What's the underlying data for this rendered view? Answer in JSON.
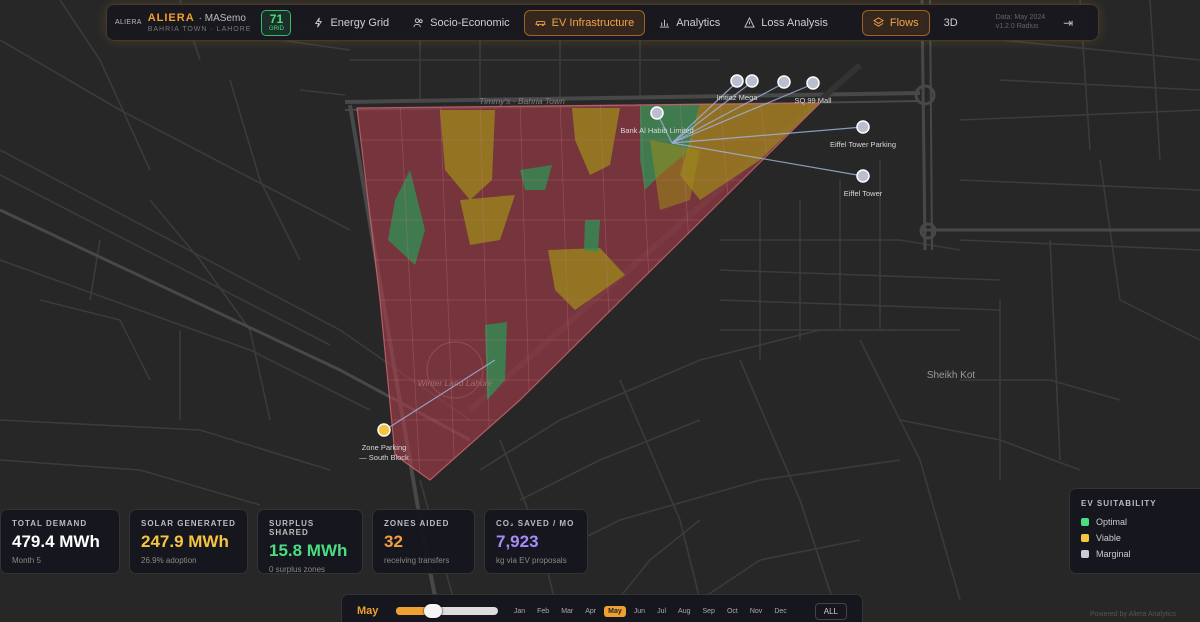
{
  "header": {
    "logo_text": "ALIERA",
    "brand": "ALIERA",
    "app_name": "· MASemo",
    "location": "BAHRIA TOWN · LAHORE",
    "grid_score": "71",
    "grid_label": "GRID",
    "tabs": [
      {
        "label": "Energy Grid",
        "icon": "bolt-icon"
      },
      {
        "label": "Socio-Economic",
        "icon": "users-icon"
      },
      {
        "label": "EV Infrastructure",
        "icon": "car-icon",
        "active": true
      },
      {
        "label": "Analytics",
        "icon": "bar-chart-icon"
      },
      {
        "label": "Loss Analysis",
        "icon": "warning-icon"
      }
    ],
    "flows_label": "Flows",
    "mode_label": "3D",
    "date_line": "Data: May 2024",
    "version_line": "v1.2.0 Radius"
  },
  "map": {
    "labels": {
      "road_top": "Timmy's - Bahria Town",
      "area_center": "Winter Land Lahore",
      "district": "Sheikh Kot"
    },
    "stations": [
      {
        "name": "Imtiaz Mega"
      },
      {
        "name": "SQ 99 Mall"
      },
      {
        "name": "Bank Al Habib Limited"
      },
      {
        "name": "Eiffel Tower Parking"
      },
      {
        "name": "Eiffel Tower"
      },
      {
        "name": "Zone Parking",
        "name2": "— South Block"
      }
    ]
  },
  "stats": [
    {
      "title": "TOTAL DEMAND",
      "value": "479.4 MWh",
      "sub": "Month 5",
      "color": "#ffffff"
    },
    {
      "title": "SOLAR GENERATED",
      "value": "247.9 MWh",
      "sub": "26.9% adoption",
      "color": "#f5c542"
    },
    {
      "title": "SURPLUS SHARED",
      "value": "15.8 MWh",
      "sub": "0 surplus zones",
      "color": "#4ade80"
    },
    {
      "title": "ZONES AIDED",
      "value": "32",
      "sub": "receiving transfers",
      "color": "#f59e42"
    },
    {
      "title": "CO₂ SAVED / MO",
      "value": "7,923",
      "sub": "kg via EV proposals",
      "color": "#a78bfa"
    }
  ],
  "legend": {
    "title": "EV SUITABILITY",
    "items": [
      {
        "label": "Optimal",
        "color": "#4ade80"
      },
      {
        "label": "Viable",
        "color": "#f5c542"
      },
      {
        "label": "Marginal",
        "color": "#c9ccd6"
      }
    ]
  },
  "timeline": {
    "current_month": "May",
    "progress": 0.36,
    "months": [
      "Jan",
      "Feb",
      "Mar",
      "Apr",
      "May",
      "Jun",
      "Jul",
      "Aug",
      "Sep",
      "Oct",
      "Nov",
      "Dec"
    ],
    "selected": "May",
    "all_label": "ALL"
  },
  "footer": {
    "powered": "Powered by Aliera Analytics"
  },
  "colors": {
    "accent": "#f0a030",
    "zone_red": "#b3454f",
    "zone_green": "#2f9d5a",
    "zone_yellow": "#a68a1e"
  }
}
